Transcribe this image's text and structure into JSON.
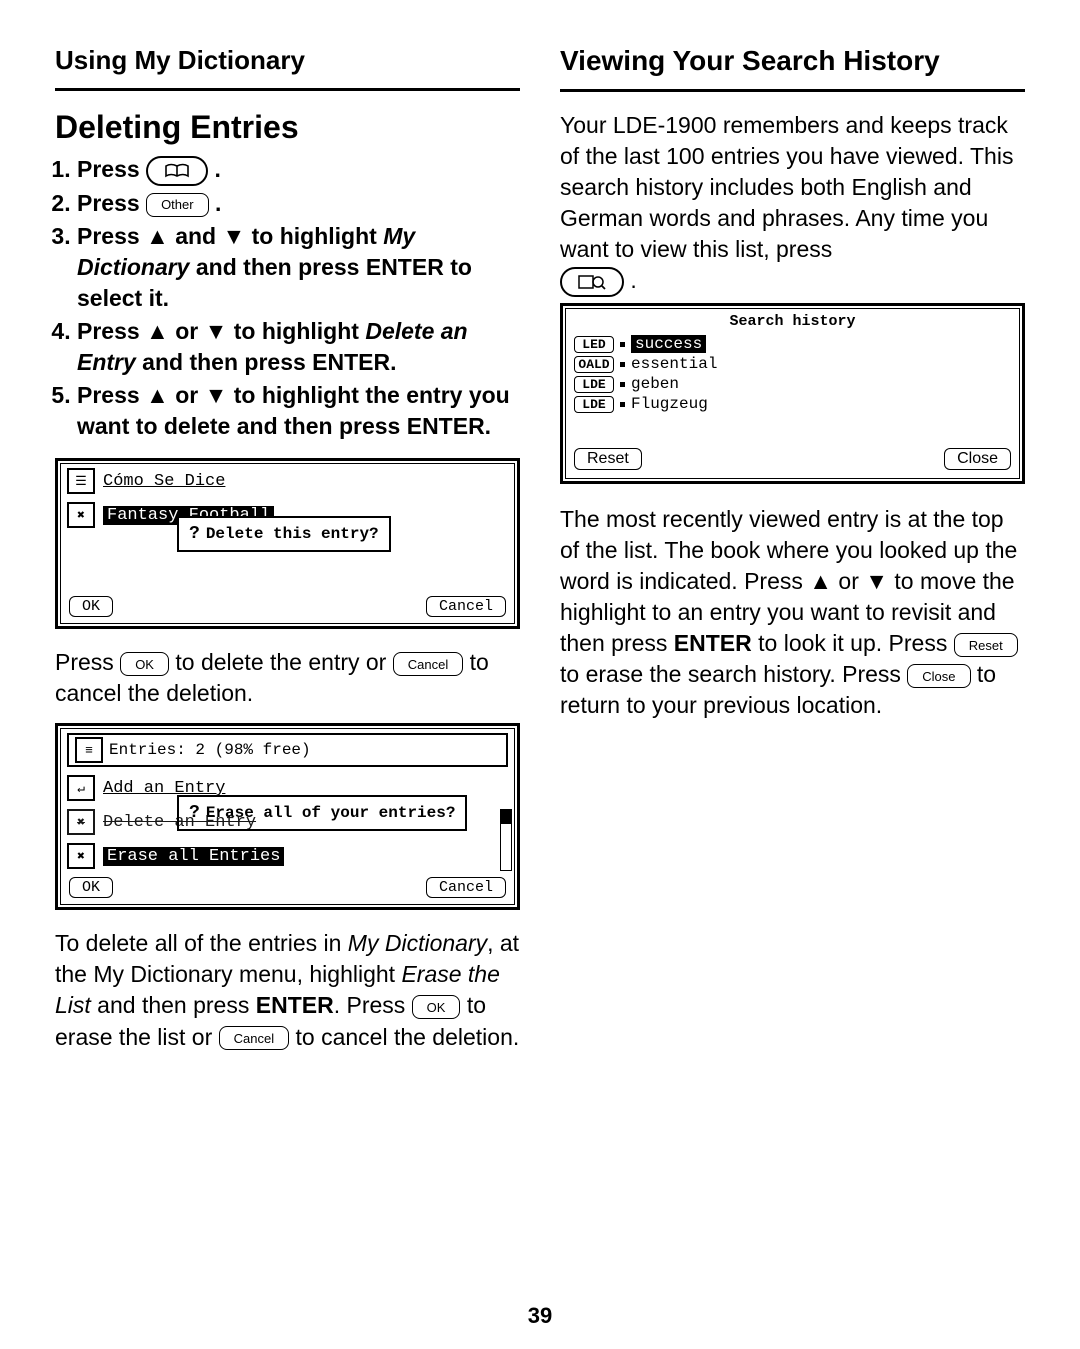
{
  "left": {
    "header": "Using My Dictionary",
    "title": "Deleting Entries",
    "step1_pre": "Press ",
    "step2_pre": "Press ",
    "other_btn": "Other",
    "step3_a": "Press ▲ and ▼ to highlight ",
    "step3_i": "My Dictionary",
    "step3_b": " and then press ENTER to select it.",
    "step4_a": "Press ▲ or ▼ to highlight ",
    "step4_i": "Delete an Entry",
    "step4_b": " and then press ENTER.",
    "step5": "Press ▲ or ▼ to highlight the entry you want to delete and then press ENTER.",
    "screen1": {
      "row1": "Cómo Se Dice",
      "row2_hl": "Fantasy Football",
      "dialog": "Delete this entry?",
      "ok": "OK",
      "cancel": "Cancel"
    },
    "para1_a": "Press ",
    "para1_ok": "OK",
    "para1_b": " to delete the entry or ",
    "para1_cancel": "Cancel",
    "para1_c": " to cancel the deletion.",
    "screen2": {
      "top": "Entries: 2 (98% free)",
      "r1": "Add an Entry",
      "dialog": "Erase all of your entries?",
      "r2": "Delete an Entry",
      "r3_hl": "Erase all Entries",
      "ok": "OK",
      "cancel": "Cancel"
    },
    "para2_a": "To delete all of the entries in ",
    "para2_i1": "My Dictionary",
    "para2_b": ", at the My Dictionary menu, highlight ",
    "para2_i2": "Erase the List",
    "para2_c": " and then press ",
    "para2_bold": "ENTER",
    "para2_d": ". Press ",
    "para2_ok": "OK",
    "para2_e": " to erase the list or ",
    "para2_cancel": "Cancel",
    "para2_f": " to cancel the deletion."
  },
  "right": {
    "header": "Viewing Your Search History",
    "para1": "Your LDE-1900 remembers and keeps track of the last 100 entries you have viewed. This search history includes both English and German words and phrases. Any time you want to view this list, press ",
    "history": {
      "title": "Search history",
      "rows": [
        {
          "tag": "LED",
          "word": "success",
          "hl": true
        },
        {
          "tag": "OALD",
          "word": "essential",
          "hl": false
        },
        {
          "tag": "LDE",
          "word": "geben",
          "hl": false
        },
        {
          "tag": "LDE",
          "word": "Flugzeug",
          "hl": false
        }
      ],
      "reset": "Reset",
      "close": "Close"
    },
    "para2_a": "The most recently viewed entry is at the top of the list. The book where you looked up the word is indicated. Press ▲ or ▼ to move the highlight to an entry you want to revisit and then press ",
    "para2_bold1": "ENTER",
    "para2_b": " to look it up. Press ",
    "para2_reset": "Reset",
    "para2_c": " to erase the search history. Press ",
    "para2_close": "Close",
    "para2_d": " to return to your previous location."
  },
  "page_number": "39"
}
